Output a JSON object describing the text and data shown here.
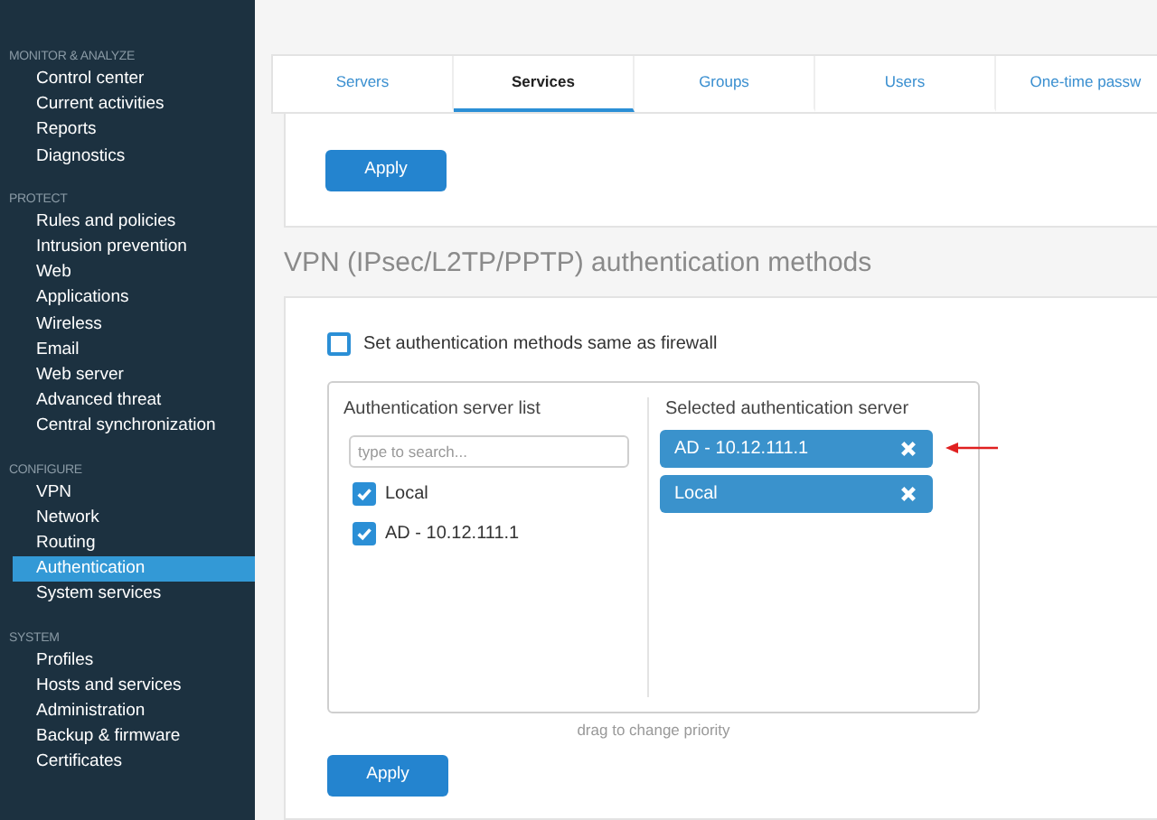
{
  "sidebar": {
    "sections": [
      {
        "heading": "MONITOR & ANALYZE",
        "items": [
          {
            "label": "Control center",
            "selected": false
          },
          {
            "label": "Current activities",
            "selected": false
          },
          {
            "label": "Reports",
            "selected": false
          },
          {
            "label": "Diagnostics",
            "selected": false
          }
        ]
      },
      {
        "heading": "PROTECT",
        "items": [
          {
            "label": "Rules and policies",
            "selected": false
          },
          {
            "label": "Intrusion prevention",
            "selected": false
          },
          {
            "label": "Web",
            "selected": false
          },
          {
            "label": "Applications",
            "selected": false
          },
          {
            "label": "Wireless",
            "selected": false
          },
          {
            "label": "Email",
            "selected": false
          },
          {
            "label": "Web server",
            "selected": false
          },
          {
            "label": "Advanced threat",
            "selected": false
          },
          {
            "label": "Central synchronization",
            "selected": false
          }
        ]
      },
      {
        "heading": "CONFIGURE",
        "items": [
          {
            "label": "VPN",
            "selected": false
          },
          {
            "label": "Network",
            "selected": false
          },
          {
            "label": "Routing",
            "selected": false
          },
          {
            "label": "Authentication",
            "selected": true
          },
          {
            "label": "System services",
            "selected": false
          }
        ]
      },
      {
        "heading": "SYSTEM",
        "items": [
          {
            "label": "Profiles",
            "selected": false
          },
          {
            "label": "Hosts and services",
            "selected": false
          },
          {
            "label": "Administration",
            "selected": false
          },
          {
            "label": "Backup & firmware",
            "selected": false
          },
          {
            "label": "Certificates",
            "selected": false
          }
        ]
      }
    ]
  },
  "tabs": [
    {
      "label": "Servers",
      "selected": false
    },
    {
      "label": "Services",
      "selected": true
    },
    {
      "label": "Groups",
      "selected": false
    },
    {
      "label": "Users",
      "selected": false
    },
    {
      "label": "One-time passw",
      "selected": false
    }
  ],
  "top_apply": "Apply",
  "section_title": "VPN (IPsec/L2TP/PPTP) authentication methods",
  "same_as_firewall": {
    "label": "Set authentication methods same as firewall",
    "checked": false
  },
  "server_list": {
    "title": "Authentication server list",
    "search": {
      "placeholder": "type to search..."
    },
    "items": [
      {
        "label": "Local",
        "checked": true
      },
      {
        "label": "AD - 10.12.111.1",
        "checked": true
      }
    ]
  },
  "selected_servers": {
    "title": "Selected authentication server",
    "items": [
      {
        "label": "AD - 10.12.111.1",
        "annotated": true
      },
      {
        "label": "Local",
        "annotated": false
      }
    ]
  },
  "hint": "drag to change priority",
  "bottom_apply": "Apply"
}
